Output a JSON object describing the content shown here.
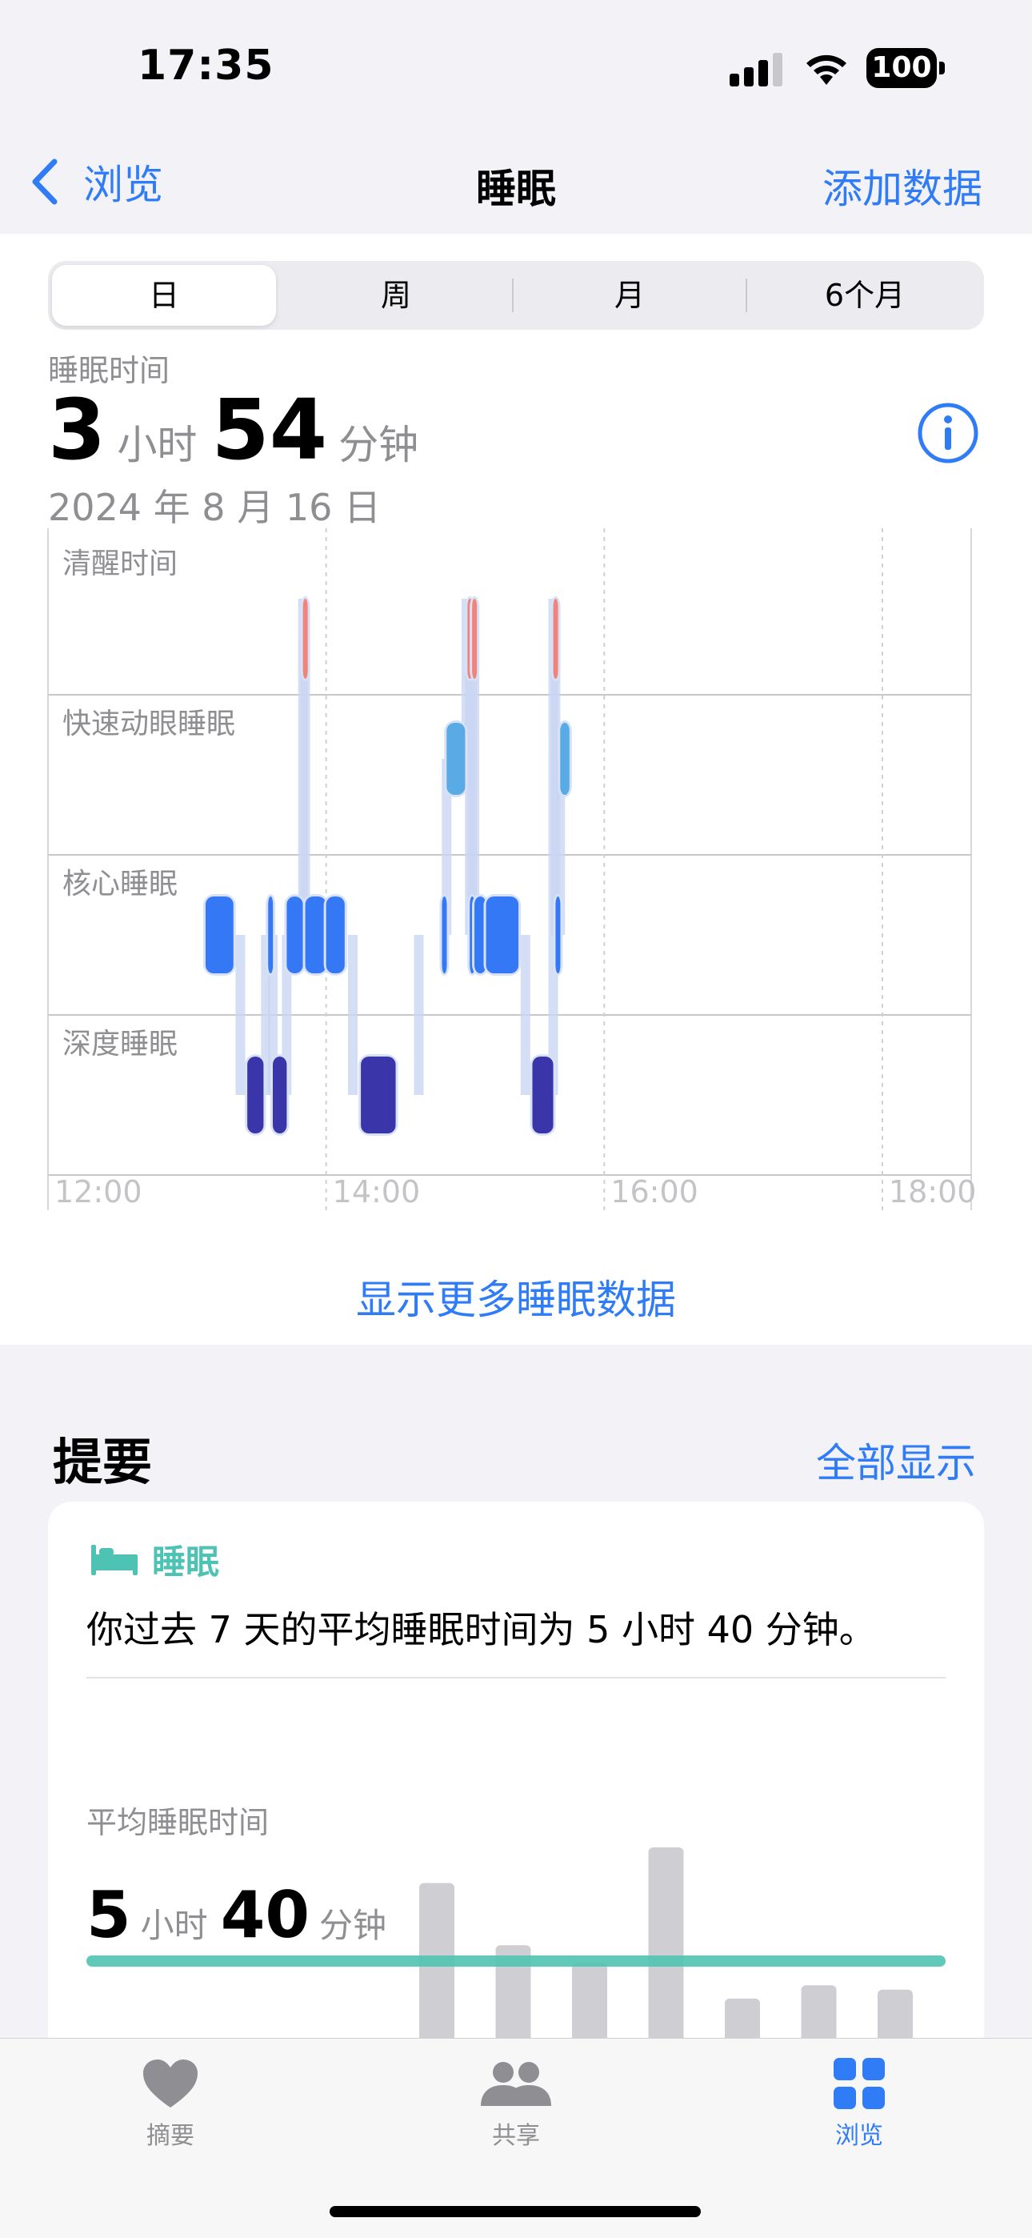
{
  "status_bar": {
    "time": "17:35",
    "battery": "100"
  },
  "nav": {
    "back_label": "浏览",
    "title": "睡眠",
    "action_label": "添加数据"
  },
  "segmented": {
    "tabs": [
      "日",
      "周",
      "月",
      "6个月"
    ],
    "selected": "日"
  },
  "summary": {
    "label": "睡眠时间",
    "hours": "3",
    "hours_unit": "小时",
    "minutes": "54",
    "minutes_unit": "分钟",
    "date": "2024 年 8 月 16 日"
  },
  "chart_data": {
    "type": "timeline",
    "stages": [
      "清醒时间",
      "快速动眼睡眠",
      "核心睡眠",
      "深度睡眠"
    ],
    "x_ticks": [
      "12:00",
      "14:00",
      "16:00",
      "18:00"
    ],
    "xlim": [
      "12:00",
      "20:00"
    ],
    "stage_colors": {
      "清醒时间": "#f0847a",
      "快速动眼睡眠": "#5aaae6",
      "核心睡眠": "#3478f6",
      "深度睡眠": "#3a35a8"
    },
    "segments": [
      {
        "stage": "核心睡眠",
        "start": "13:08",
        "end": "13:20"
      },
      {
        "stage": "深度睡眠",
        "start": "13:26",
        "end": "13:33"
      },
      {
        "stage": "核心睡眠",
        "start": "13:35",
        "end": "13:37"
      },
      {
        "stage": "深度睡眠",
        "start": "13:37",
        "end": "13:43"
      },
      {
        "stage": "核心睡眠",
        "start": "13:43",
        "end": "13:50"
      },
      {
        "stage": "清醒时间",
        "start": "13:50",
        "end": "13:51"
      },
      {
        "stage": "核心睡眠",
        "start": "13:51",
        "end": "14:00"
      },
      {
        "stage": "核心睡眠",
        "start": "14:00",
        "end": "14:08"
      },
      {
        "stage": "深度睡眠",
        "start": "14:15",
        "end": "14:30"
      },
      {
        "stage": "核心睡眠",
        "start": "14:50",
        "end": "14:52"
      },
      {
        "stage": "快速动眼睡眠",
        "start": "14:52",
        "end": "15:00"
      },
      {
        "stage": "清醒时间",
        "start": "15:01",
        "end": "15:02"
      },
      {
        "stage": "核心睡眠",
        "start": "15:02",
        "end": "15:03"
      },
      {
        "stage": "清醒时间",
        "start": "15:03",
        "end": "15:04"
      },
      {
        "stage": "核心睡眠",
        "start": "15:04",
        "end": "15:09"
      },
      {
        "stage": "核心睡眠",
        "start": "15:09",
        "end": "15:23"
      },
      {
        "stage": "深度睡眠",
        "start": "15:29",
        "end": "15:38"
      },
      {
        "stage": "清醒时间",
        "start": "15:38",
        "end": "15:39"
      },
      {
        "stage": "核心睡眠",
        "start": "15:39",
        "end": "15:41"
      },
      {
        "stage": "快速动眼睡眠",
        "start": "15:41",
        "end": "15:45"
      }
    ]
  },
  "show_more": "显示更多睡眠数据",
  "highlights": {
    "title": "提要",
    "show_all": "全部显示",
    "category": "睡眠",
    "text": "你过去 7 天的平均睡眠时间为 5 小时 40 分钟。",
    "avg_label": "平均睡眠时间",
    "avg_hours": "5",
    "avg_hours_unit": "小时",
    "avg_minutes": "40",
    "avg_minutes_unit": "分钟",
    "bar_chart": {
      "type": "bar",
      "values": [
        7.3,
        5.9,
        5.5,
        8.1,
        4.7,
        5.0,
        4.9
      ],
      "average": 5.67,
      "ylim": [
        0,
        9
      ]
    }
  },
  "tabbar": {
    "items": [
      "摘要",
      "共享",
      "浏览"
    ],
    "active": "浏览"
  },
  "colors": {
    "accent": "#2f7cf6",
    "sleep_teal": "#4fc3b3"
  }
}
